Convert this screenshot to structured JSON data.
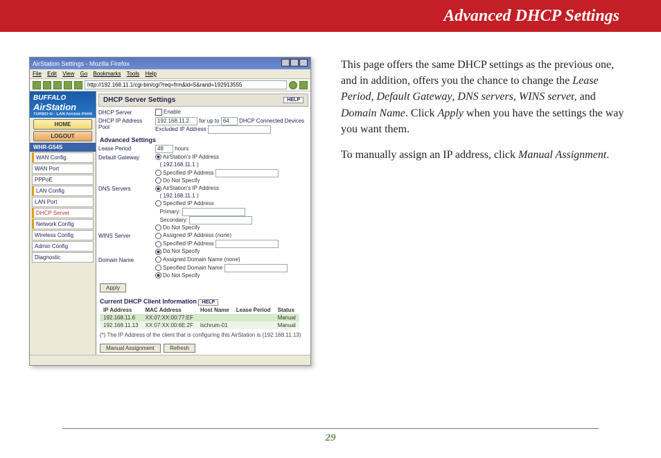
{
  "document": {
    "title": "Advanced DHCP Settings",
    "page_number": "29",
    "para1_a": "This page offers the same DHCP settings as the previous one, and in addition, offers you the chance to change the ",
    "para1_lease": "Lease Period",
    "sep1": ", ",
    "para1_gateway": "Default Gateway",
    "sep2": ", ",
    "para1_dns": "DNS servers",
    "sep3": ", ",
    "para1_wins": "WINS serve",
    "para1_b": "r, and ",
    "para1_domain": "Domain Name",
    "para1_c": ".  Click ",
    "para1_apply": "Apply",
    "para1_d": " when you have the settings the way you want them.",
    "para2_a": "To manually assign an IP address, click ",
    "para2_manual": "Manual Assignment",
    "para2_b": "."
  },
  "shot": {
    "window_title": "AirStation Settings - Mozilla Firefox",
    "menu": {
      "file": "File",
      "edit": "Edit",
      "view": "View",
      "go": "Go",
      "bookmarks": "Bookmarks",
      "tools": "Tools",
      "help": "Help"
    },
    "url": "http://192.168.11.1/cgi-bin/cgi?req=frm&id=5&rand=192913555",
    "brand_top": "BUFFALO",
    "brand_main": "AirStation",
    "brand_sub": "TURBO-G · LAN Access Point",
    "home": "HOME",
    "logout": "LOGOUT",
    "model": "WHR-G54S",
    "nav": [
      "WAN Config",
      "WAN Port",
      "PPPoE",
      "LAN Config",
      "LAN Port",
      "DHCP Server",
      "Network Config",
      "Wireless Config",
      "Admin Config",
      "Diagnostic"
    ],
    "panel_title": "DHCP Server Settings",
    "help": "HELP",
    "dhcp_server_label": "DHCP Server",
    "dhcp_server_val": "Enable",
    "pool_label": "DHCP IP Address Pool",
    "pool_ip": "192.168.11.2",
    "pool_for": "for up to",
    "pool_count": "64",
    "pool_note": "DHCP Connected Devices",
    "excluded_label": "Excluded IP Address",
    "advanced_hdr": "Advanced Settings",
    "lease_label": "Lease Period",
    "lease_val": "48",
    "lease_unit": "hours",
    "gw_label": "Default Gateway",
    "gw_opt1": "AirStation's IP Address",
    "gw_opt1_ip": "( 192.168.11.1 )",
    "gw_opt2": "Specified IP Address",
    "gw_opt3": "Do Not Specify",
    "dns_label": "DNS Servers",
    "dns_opt1": "AirStation's IP Address",
    "dns_opt1_ip": "( 192.168.11.1 )",
    "dns_opt2": "Specified IP Address",
    "dns_primary": "Primary:",
    "dns_secondary": "Secondary:",
    "dns_opt3": "Do Not Specify",
    "wins_label": "WINS Server",
    "wins_opt1": "Assigned IP Address (none)",
    "wins_opt2": "Specified IP Address",
    "wins_opt3": "Do Not Specify",
    "domain_label": "Domain Name",
    "domain_opt1": "Assigned Domain Name (none)",
    "domain_opt2": "Specified Domain Name",
    "domain_opt3": "Do Not Specify",
    "apply": "Apply",
    "clients_hdr": "Current DHCP Client Information",
    "tbl": {
      "c1": "IP Address",
      "c2": "MAC Address",
      "c3": "Host Name",
      "c4": "Lease Period",
      "c5": "Status",
      "r1c1": "192.168.11.6",
      "r1c2": "XX:07:XX:00:77:EF",
      "r1c3": "",
      "r1c4": "",
      "r1c5": "Manual",
      "r2c1": "192.168.11.13",
      "r2c2": "XX:07:XX:00:6E:2F",
      "r2c3": "lschrum-01",
      "r2c4": "",
      "r2c5": "Manual"
    },
    "foot_note": "(*) The IP Address of the client that is configuring this AirStation is (192.168.11.13)",
    "manual_btn": "Manual Assignment",
    "refresh_btn": "Refresh"
  }
}
